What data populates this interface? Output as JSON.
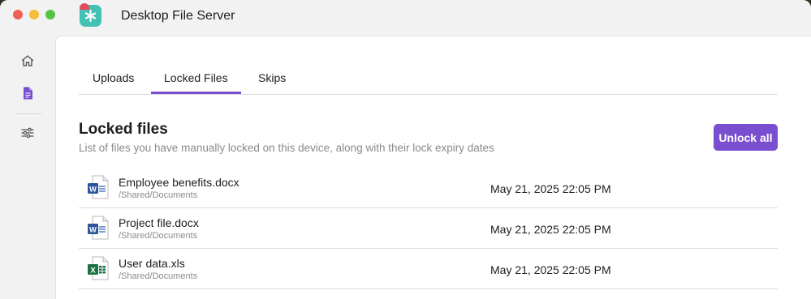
{
  "app": {
    "title": "Desktop File Server"
  },
  "tabs": [
    {
      "label": "Uploads"
    },
    {
      "label": "Locked Files",
      "active": true
    },
    {
      "label": "Skips"
    }
  ],
  "section": {
    "title": "Locked files",
    "subtitle": "List of files you have manually locked on this device, along with their lock expiry dates",
    "unlock_all_label": "Unlock all"
  },
  "files": [
    {
      "name": "Employee benefits.docx",
      "path": "/Shared/Documents",
      "date": "May 21, 2025 22:05 PM",
      "icon": "word-file-icon"
    },
    {
      "name": "Project file.docx",
      "path": "/Shared/Documents",
      "date": "May 21, 2025 22:05 PM",
      "icon": "word-file-icon"
    },
    {
      "name": "User data.xls",
      "path": "/Shared/Documents",
      "date": "May 21, 2025 22:05 PM",
      "icon": "excel-file-icon"
    }
  ],
  "sidebar": {
    "items": [
      "home-icon",
      "document-icon",
      "settings-sliders-icon"
    ]
  },
  "colors": {
    "accent": "#7a4fcf",
    "close": "#ee5f57",
    "minimize": "#f5bd3b",
    "maximize": "#55c241",
    "app_icon": "#43c1b5"
  }
}
